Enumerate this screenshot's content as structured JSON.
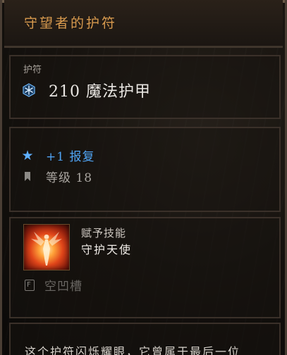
{
  "header": {
    "title": "守望者的护符"
  },
  "armor_panel": {
    "type_label": "护符",
    "stat": "210 魔法护甲",
    "stat_icon": "snowflake-icon"
  },
  "affix_panel": {
    "affix": "+1 报复",
    "affix_icon": "star-icon",
    "level": "等级 18",
    "level_icon": "flag-icon"
  },
  "skill_panel": {
    "caption": "赋予技能",
    "skill_name": "守护天使",
    "socket_glyph": "F",
    "socket_label": "空凹槽"
  },
  "flavor_panel": {
    "text": "这个护符闪烁耀眼，它曾属于最后一位"
  },
  "colors": {
    "title": "#d89a4e",
    "affix": "#4fa3f2",
    "stat_icon": "#9cd0ff"
  }
}
